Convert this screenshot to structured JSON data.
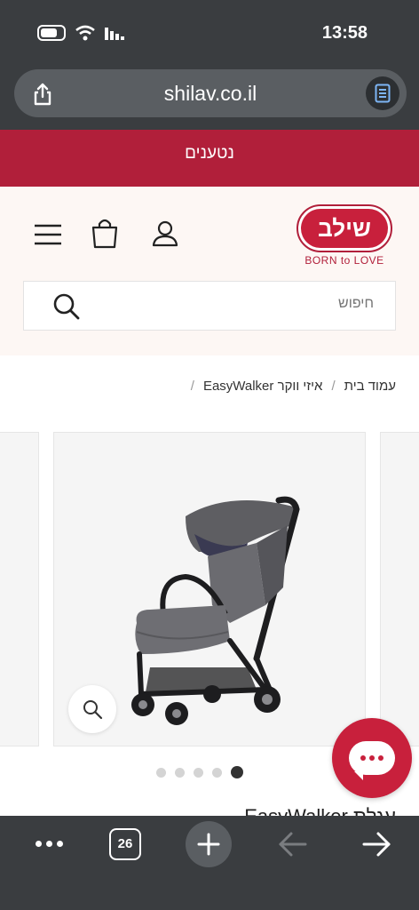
{
  "status_bar": {
    "time": "13:58"
  },
  "browser": {
    "url": "shilav.co.il",
    "tab_count": "26"
  },
  "promo": {
    "text": "נטענים"
  },
  "header": {
    "logo_text": "שילב",
    "tagline": "BORN to LOVE",
    "search_placeholder": "חיפוש"
  },
  "breadcrumb": {
    "home": "עמוד בית",
    "category": "איזי ווקר EasyWalker",
    "separator": "/"
  },
  "gallery": {
    "dot_count": 5,
    "active_dot": 5
  },
  "product": {
    "title_peek": "עגלת EasyWalker"
  },
  "colors": {
    "brand": "#c8203c",
    "chrome": "#3a3d40"
  }
}
